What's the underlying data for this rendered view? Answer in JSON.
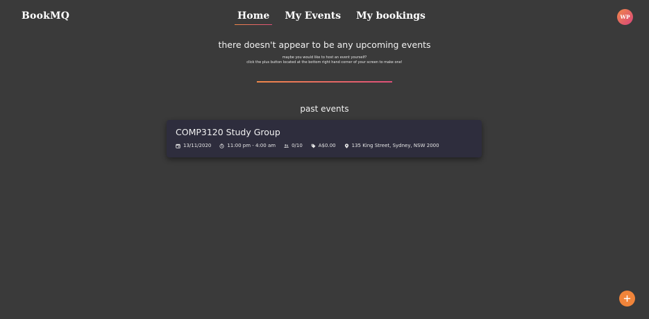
{
  "header": {
    "brand": "BookMQ",
    "nav": [
      {
        "label": "Home",
        "active": true
      },
      {
        "label": "My Events",
        "active": false
      },
      {
        "label": "My bookings",
        "active": false
      }
    ],
    "avatar_initials": "WP"
  },
  "upcoming": {
    "empty_title": "there doesn't appear to be any upcoming events",
    "empty_line1": "maybe you would like to host an event yourself?",
    "empty_line2": "click the plus button located at the bottom right hand corner of your screen to make one!"
  },
  "past": {
    "section_title": "past events",
    "events": [
      {
        "title": "COMP3120 Study Group",
        "date": "13/11/2020",
        "time": "11:00 pm - 4:00 am",
        "attendees": "0/10",
        "price": "A$0.00",
        "location": "135 King Street, Sydney, NSW 2000"
      }
    ]
  },
  "fab": {
    "icon": "plus-icon"
  },
  "colors": {
    "background": "#3a3a3a",
    "card": "#2e2d3d",
    "accent_orange": "#f0843a",
    "accent_pink": "#e0507a"
  }
}
